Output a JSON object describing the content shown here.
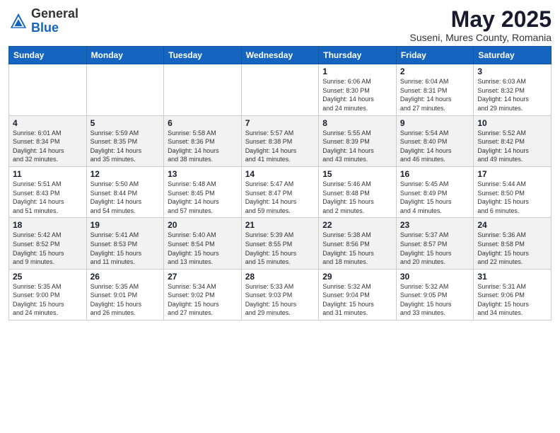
{
  "logo": {
    "general": "General",
    "blue": "Blue"
  },
  "header": {
    "title": "May 2025",
    "subtitle": "Suseni, Mures County, Romania"
  },
  "weekdays": [
    "Sunday",
    "Monday",
    "Tuesday",
    "Wednesday",
    "Thursday",
    "Friday",
    "Saturday"
  ],
  "weeks": [
    [
      {
        "day": "",
        "info": ""
      },
      {
        "day": "",
        "info": ""
      },
      {
        "day": "",
        "info": ""
      },
      {
        "day": "",
        "info": ""
      },
      {
        "day": "1",
        "info": "Sunrise: 6:06 AM\nSunset: 8:30 PM\nDaylight: 14 hours\nand 24 minutes."
      },
      {
        "day": "2",
        "info": "Sunrise: 6:04 AM\nSunset: 8:31 PM\nDaylight: 14 hours\nand 27 minutes."
      },
      {
        "day": "3",
        "info": "Sunrise: 6:03 AM\nSunset: 8:32 PM\nDaylight: 14 hours\nand 29 minutes."
      }
    ],
    [
      {
        "day": "4",
        "info": "Sunrise: 6:01 AM\nSunset: 8:34 PM\nDaylight: 14 hours\nand 32 minutes."
      },
      {
        "day": "5",
        "info": "Sunrise: 5:59 AM\nSunset: 8:35 PM\nDaylight: 14 hours\nand 35 minutes."
      },
      {
        "day": "6",
        "info": "Sunrise: 5:58 AM\nSunset: 8:36 PM\nDaylight: 14 hours\nand 38 minutes."
      },
      {
        "day": "7",
        "info": "Sunrise: 5:57 AM\nSunset: 8:38 PM\nDaylight: 14 hours\nand 41 minutes."
      },
      {
        "day": "8",
        "info": "Sunrise: 5:55 AM\nSunset: 8:39 PM\nDaylight: 14 hours\nand 43 minutes."
      },
      {
        "day": "9",
        "info": "Sunrise: 5:54 AM\nSunset: 8:40 PM\nDaylight: 14 hours\nand 46 minutes."
      },
      {
        "day": "10",
        "info": "Sunrise: 5:52 AM\nSunset: 8:42 PM\nDaylight: 14 hours\nand 49 minutes."
      }
    ],
    [
      {
        "day": "11",
        "info": "Sunrise: 5:51 AM\nSunset: 8:43 PM\nDaylight: 14 hours\nand 51 minutes."
      },
      {
        "day": "12",
        "info": "Sunrise: 5:50 AM\nSunset: 8:44 PM\nDaylight: 14 hours\nand 54 minutes."
      },
      {
        "day": "13",
        "info": "Sunrise: 5:48 AM\nSunset: 8:45 PM\nDaylight: 14 hours\nand 57 minutes."
      },
      {
        "day": "14",
        "info": "Sunrise: 5:47 AM\nSunset: 8:47 PM\nDaylight: 14 hours\nand 59 minutes."
      },
      {
        "day": "15",
        "info": "Sunrise: 5:46 AM\nSunset: 8:48 PM\nDaylight: 15 hours\nand 2 minutes."
      },
      {
        "day": "16",
        "info": "Sunrise: 5:45 AM\nSunset: 8:49 PM\nDaylight: 15 hours\nand 4 minutes."
      },
      {
        "day": "17",
        "info": "Sunrise: 5:44 AM\nSunset: 8:50 PM\nDaylight: 15 hours\nand 6 minutes."
      }
    ],
    [
      {
        "day": "18",
        "info": "Sunrise: 5:42 AM\nSunset: 8:52 PM\nDaylight: 15 hours\nand 9 minutes."
      },
      {
        "day": "19",
        "info": "Sunrise: 5:41 AM\nSunset: 8:53 PM\nDaylight: 15 hours\nand 11 minutes."
      },
      {
        "day": "20",
        "info": "Sunrise: 5:40 AM\nSunset: 8:54 PM\nDaylight: 15 hours\nand 13 minutes."
      },
      {
        "day": "21",
        "info": "Sunrise: 5:39 AM\nSunset: 8:55 PM\nDaylight: 15 hours\nand 15 minutes."
      },
      {
        "day": "22",
        "info": "Sunrise: 5:38 AM\nSunset: 8:56 PM\nDaylight: 15 hours\nand 18 minutes."
      },
      {
        "day": "23",
        "info": "Sunrise: 5:37 AM\nSunset: 8:57 PM\nDaylight: 15 hours\nand 20 minutes."
      },
      {
        "day": "24",
        "info": "Sunrise: 5:36 AM\nSunset: 8:58 PM\nDaylight: 15 hours\nand 22 minutes."
      }
    ],
    [
      {
        "day": "25",
        "info": "Sunrise: 5:35 AM\nSunset: 9:00 PM\nDaylight: 15 hours\nand 24 minutes."
      },
      {
        "day": "26",
        "info": "Sunrise: 5:35 AM\nSunset: 9:01 PM\nDaylight: 15 hours\nand 26 minutes."
      },
      {
        "day": "27",
        "info": "Sunrise: 5:34 AM\nSunset: 9:02 PM\nDaylight: 15 hours\nand 27 minutes."
      },
      {
        "day": "28",
        "info": "Sunrise: 5:33 AM\nSunset: 9:03 PM\nDaylight: 15 hours\nand 29 minutes."
      },
      {
        "day": "29",
        "info": "Sunrise: 5:32 AM\nSunset: 9:04 PM\nDaylight: 15 hours\nand 31 minutes."
      },
      {
        "day": "30",
        "info": "Sunrise: 5:32 AM\nSunset: 9:05 PM\nDaylight: 15 hours\nand 33 minutes."
      },
      {
        "day": "31",
        "info": "Sunrise: 5:31 AM\nSunset: 9:06 PM\nDaylight: 15 hours\nand 34 minutes."
      }
    ]
  ]
}
